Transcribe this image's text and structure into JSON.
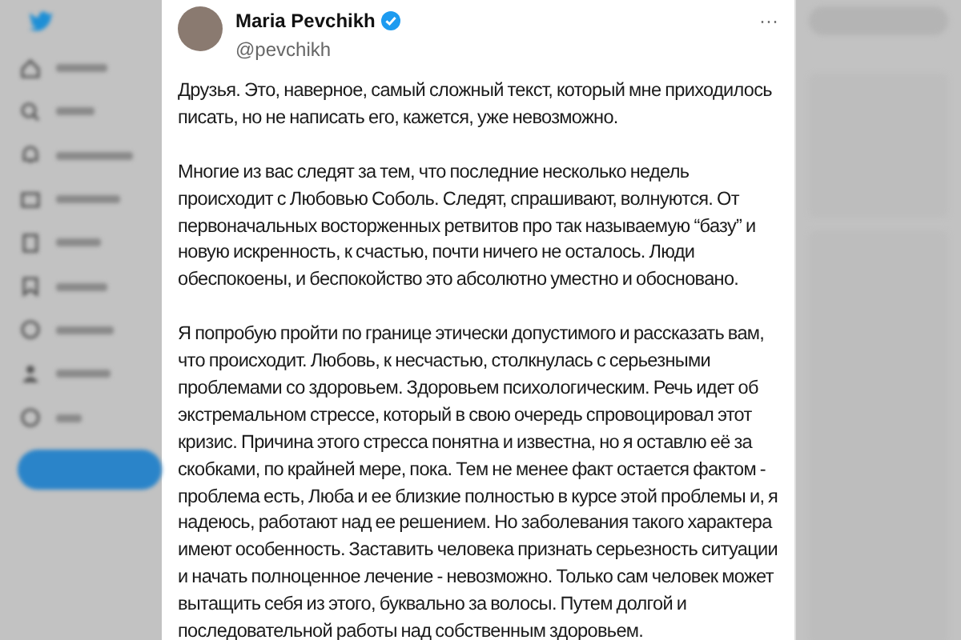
{
  "tweet": {
    "author": "Maria Pevchikh",
    "verified": true,
    "handle": "@pevchikh",
    "more": "···",
    "paragraphs": [
      "Друзья. Это, наверное, самый сложный текст, который мне приходилось писать, но не написать его, кажется, уже невозможно.",
      "Многие из вас следят за тем, что последние несколько недель происходит с Любовью Соболь. Следят, спрашивают, волнуются. От первоначальных восторженных ретвитов про так называемую “базу” и новую искренность, к счастью, почти ничего не осталось. Люди обеспокоены, и беспокойство это абсолютно уместно и обосновано.",
      "Я попробую пройти по границе этически допустимого и рассказать вам, что происходит. Любовь, к несчастью, столкнулась с серьезными проблемами со здоровьем. Здоровьем психологическим. Речь идет об экстремальном стрессе, который в свою очередь спровоцировал этот кризис. Причина этого стресса понятна и известна, но я оставлю её за скобками, по крайней мере, пока. Тем не менее факт остается фактом - проблема есть, Люба и ее близкие полностью в курсе этой проблемы и, я надеюсь, работают над ее решением. Но заболевания такого характера имеют особенность. Заставить человека признать серьезность ситуации и начать полноценное лечение - невозможно. Только сам человек может вытащить себя из этого, буквально за волосы. Путем долгой и последовательной работы над собственным здоровьем."
    ]
  }
}
